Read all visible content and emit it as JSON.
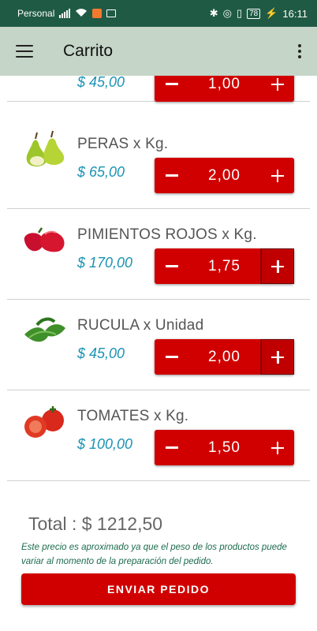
{
  "status_bar": {
    "carrier": "Personal",
    "battery": "78",
    "time": "16:11"
  },
  "app_bar": {
    "title": "Carrito"
  },
  "cart": {
    "items": [
      {
        "name": "",
        "price": "$ 45,00",
        "quantity": "1,00",
        "image": "partial-item-image"
      },
      {
        "name": "PERAS x Kg.",
        "price": "$ 65,00",
        "quantity": "2,00",
        "image": "pears-image"
      },
      {
        "name": "PIMIENTOS ROJOS x Kg.",
        "price": "$ 170,00",
        "quantity": "1,75",
        "image": "red-peppers-image"
      },
      {
        "name": "RUCULA x Unidad",
        "price": "$ 45,00",
        "quantity": "2,00",
        "image": "arugula-image"
      },
      {
        "name": "TOMATES x Kg.",
        "price": "$ 100,00",
        "quantity": "1,50",
        "image": "tomatoes-image"
      }
    ]
  },
  "footer": {
    "total": "Total : $ 1212,50",
    "note": "Este precio es aproximado ya que el peso de los productos puede variar al momento de la preparación del pedido.",
    "send_label": "ENVIAR PEDIDO"
  },
  "colors": {
    "status_bar": "#1f5a45",
    "app_bar": "#c5d5c7",
    "accent_red": "#d00000",
    "price_blue": "#1a93b4",
    "note_green": "#1c6b4d"
  }
}
